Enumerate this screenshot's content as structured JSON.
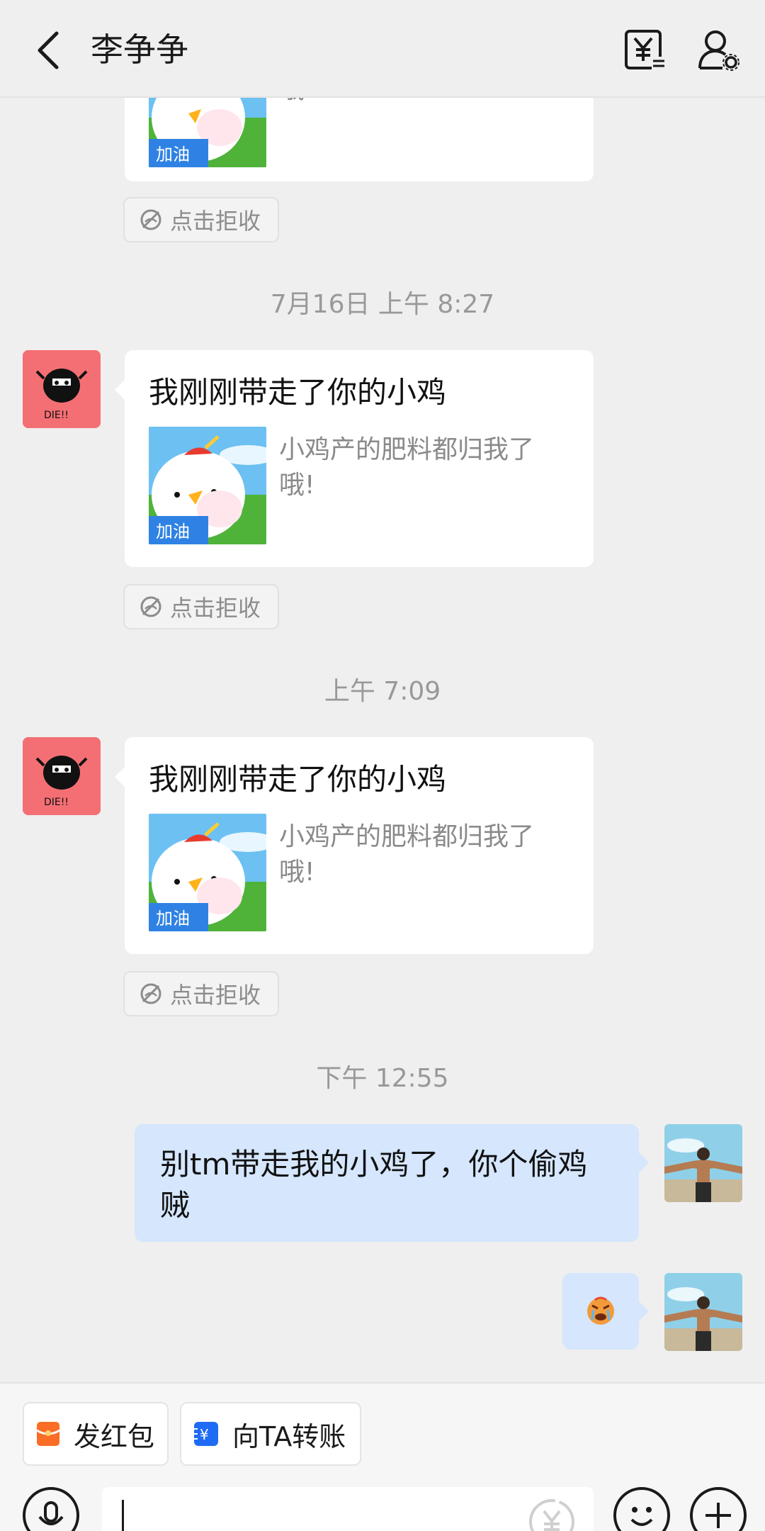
{
  "header": {
    "title": "李争争",
    "back_icon": "chevron-left-icon",
    "pay_icon": "yuan-transfer-icon",
    "profile_icon": "user-settings-icon"
  },
  "messages": [
    {
      "type": "card",
      "title": "",
      "desc": "哦!"
    },
    {
      "type": "reject",
      "label": "点击拒收"
    },
    {
      "type": "time",
      "text": "7月16日 上午 8:27"
    },
    {
      "type": "card",
      "title": "我刚刚带走了你的小鸡",
      "desc": "小鸡产的肥料都归我了哦!"
    },
    {
      "type": "reject",
      "label": "点击拒收"
    },
    {
      "type": "time",
      "text": "上午 7:09"
    },
    {
      "type": "card",
      "title": "我刚刚带走了你的小鸡",
      "desc": "小鸡产的肥料都归我了哦!"
    },
    {
      "type": "reject",
      "label": "点击拒收"
    },
    {
      "type": "time",
      "text": "下午 12:55"
    },
    {
      "type": "text-right",
      "text": "别tm带走我的小鸡了，你个偷鸡贼"
    },
    {
      "type": "emoji-right",
      "emoji": "angry-crying-face"
    }
  ],
  "thumb_badge": "加油",
  "bottom": {
    "red_packet_label": "发红包",
    "transfer_label": "向TA转账",
    "voice_icon": "microphone-icon",
    "emoji_icon": "smile-icon",
    "plus_icon": "plus-icon",
    "input_value": ""
  },
  "colors": {
    "background": "#efefef",
    "bubble_right": "#d5e6fd",
    "avatar_left": "#f46f73",
    "red_packet": "#fa6d27",
    "transfer": "#1f6bf3"
  }
}
